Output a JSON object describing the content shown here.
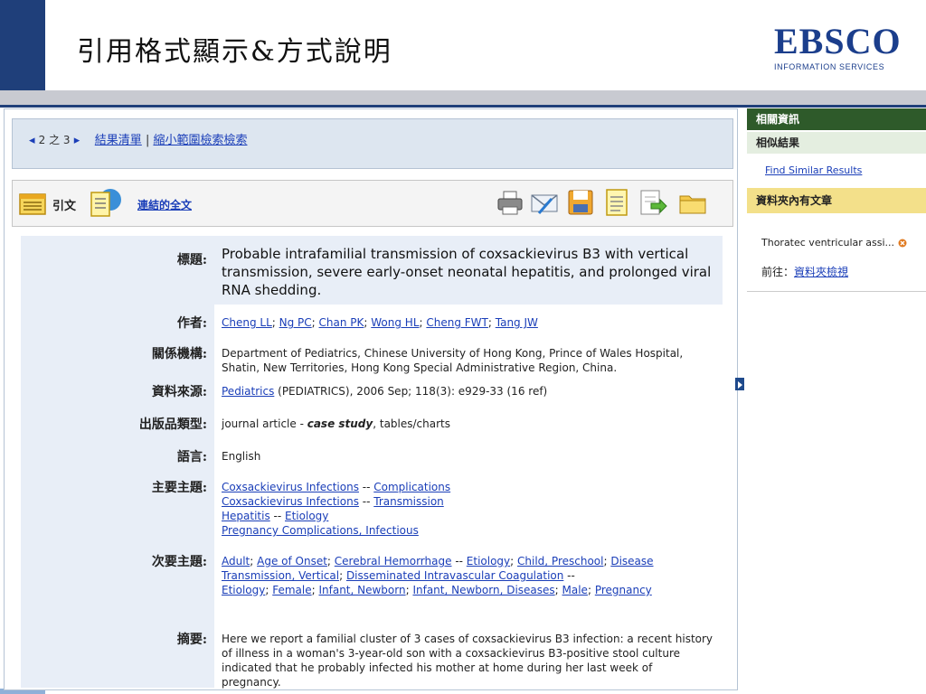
{
  "slide": {
    "title": "引用格式顯示&方式說明"
  },
  "logo": {
    "name": "EBSCO",
    "tagline": "INFORMATION SERVICES"
  },
  "nav": {
    "prev": "◂",
    "position": "2 之 3",
    "next": "▸",
    "result_list": "結果清單",
    "sep": "|",
    "refine": "縮小範圍檢索檢索"
  },
  "toolbar": {
    "citation": "引文",
    "linked_full_text": "連結的全文",
    "tools": [
      "print-icon",
      "email-icon",
      "save-icon",
      "cite-icon",
      "export-icon",
      "add-to-folder-icon"
    ]
  },
  "record": {
    "labels": {
      "title": "標題:",
      "authors": "作者:",
      "affiliation": "關係機構:",
      "source": "資料來源:",
      "pubtype": "出版品類型:",
      "language": "語言:",
      "major": "主要主題:",
      "minor": "次要主題:",
      "abstract": "摘要:"
    },
    "title": "Probable intrafamilial transmission of coxsackievirus B3 with vertical transmission, severe early-onset neonatal hepatitis, and prolonged viral RNA shedding.",
    "authors": [
      "Cheng LL",
      "Ng PC",
      "Chan PK",
      "Wong HL",
      "Cheng FWT",
      "Tang JW"
    ],
    "author_sep": "; ",
    "affiliation": "Department of Pediatrics, Chinese University of Hong Kong, Prince of Wales Hospital, Shatin, New Territories, Hong Kong Special Administrative Region, China.",
    "source_link": "Pediatrics",
    "source_rest": " (PEDIATRICS), 2006 Sep; 118(3): e929-33 (16 ref)",
    "pubtype_a": "journal article - ",
    "pubtype_b": "case study",
    "pubtype_c": ", tables/charts",
    "language": "English",
    "major": [
      [
        "Coxsackievirus Infections",
        " -- ",
        "Complications"
      ],
      [
        "Coxsackievirus Infections",
        " -- ",
        "Transmission"
      ],
      [
        "Hepatitis",
        " -- ",
        "Etiology"
      ],
      [
        "Pregnancy Complications, Infectious",
        "",
        ""
      ]
    ],
    "minor_line1": [
      "Adult",
      "; ",
      "Age of Onset",
      "; ",
      "Cerebral Hemorrhage",
      " -- ",
      "Etiology",
      "; ",
      "Child, Preschool",
      "; ",
      "Disease"
    ],
    "minor_line2": [
      "Transmission, Vertical",
      "; ",
      "Disseminated Intravascular Coagulation",
      " --",
      "",
      "",
      "",
      "",
      "",
      "",
      ""
    ],
    "minor_line3": [
      "Etiology",
      "; ",
      "Female",
      "; ",
      "Infant, Newborn",
      "; ",
      "Infant, Newborn, Diseases",
      "; ",
      "Male",
      "; ",
      "Pregnancy"
    ],
    "abstract": "Here we report a familial cluster of 3 cases of coxsackievirus B3 infection: a recent history of illness in a woman's 3-year-old son with a coxsackievirus B3-positive stool culture indicated that he probably infected his mother at home during her last week of pregnancy."
  },
  "sidebar": {
    "header": "相關資訊",
    "similar_header": "相似結果",
    "find_similar": "Find Similar Results",
    "folder_header": "資料夾內有文章",
    "folder_item": "Thoratec ventricular assi...",
    "goto_label": "前往：",
    "goto_link": "資料夾檢視"
  },
  "colors": {
    "accent_navy": "#1f3f7a",
    "link_blue": "#1a3eb8",
    "sidebar_green": "#2e5a2a",
    "folder_yellow": "#f3e08a",
    "arrow_red": "#e01010"
  }
}
